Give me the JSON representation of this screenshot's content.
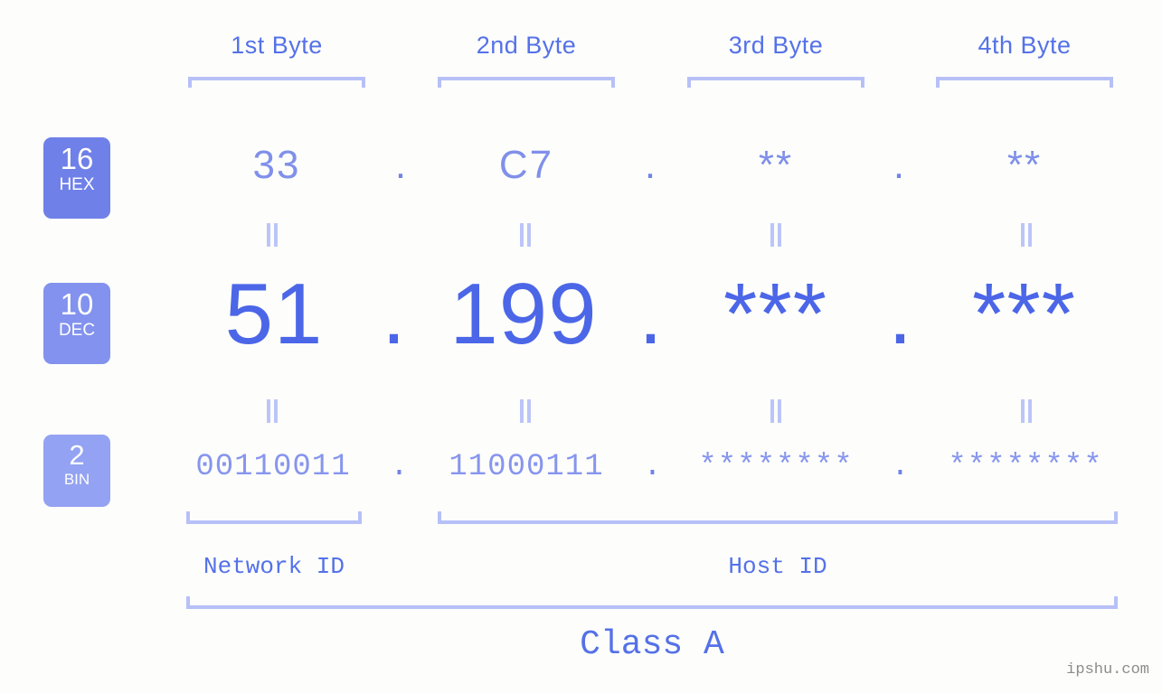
{
  "background_color": "#fdfefb",
  "accent_colors": {
    "hex_row": "#8090ea",
    "dec_row": "#4c66e8",
    "bin_row": "#8795ee",
    "bracket": "#b7c0f7",
    "header": "#5571e8",
    "badge_hex": "#6f80e8",
    "badge_dec": "#8292ee",
    "badge_bin": "#93a2f2",
    "watermark": "#8c8c8c"
  },
  "byte_headers": [
    {
      "label": "1st Byte"
    },
    {
      "label": "2nd Byte"
    },
    {
      "label": "3rd Byte"
    },
    {
      "label": "4th Byte"
    }
  ],
  "bases": [
    {
      "number": "16",
      "name": "HEX"
    },
    {
      "number": "10",
      "name": "DEC"
    },
    {
      "number": "2",
      "name": "BIN"
    }
  ],
  "rows": {
    "hex": {
      "base": "16",
      "base_name": "HEX",
      "values": [
        "33",
        "C7",
        "**",
        "**"
      ],
      "separator": "."
    },
    "dec": {
      "base": "10",
      "base_name": "DEC",
      "values": [
        "51",
        "199",
        "***",
        "***"
      ],
      "separator": "."
    },
    "bin": {
      "base": "2",
      "base_name": "BIN",
      "values": [
        "00110011",
        "11000111",
        "********",
        "********"
      ],
      "separator": "."
    }
  },
  "equality_marks": {
    "glyph": "=",
    "count_per_gap": 4,
    "gaps": 2
  },
  "segments": {
    "network_id": "Network ID",
    "host_id": "Host ID"
  },
  "class": {
    "label": "Class A"
  },
  "watermark": "ipshu.com"
}
